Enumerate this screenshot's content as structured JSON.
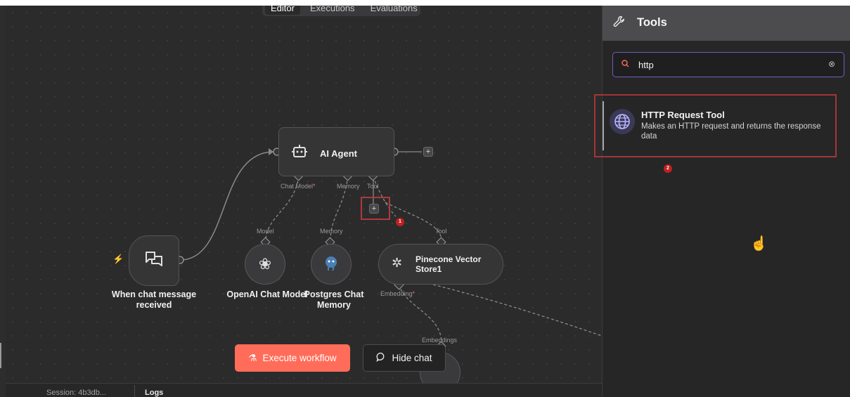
{
  "tabs": [
    "Editor",
    "Executions",
    "Evaluations"
  ],
  "nodes": {
    "agent": {
      "title": "AI Agent",
      "icon": "robot-icon"
    },
    "trigger": {
      "title": "When chat message received",
      "icon": "chat-bubbles-icon"
    },
    "openai": {
      "title": "OpenAI Chat Model",
      "icon": "openai-icon"
    },
    "postgres": {
      "title": "Postgres Chat Memory",
      "icon": "postgres-elephant-icon"
    },
    "pinecone": {
      "title": "Pinecone Vector Store1",
      "icon": "pinecone-icon"
    }
  },
  "ports": {
    "chat_model": "Chat Model",
    "memory": "Memory",
    "tool": "Tool",
    "model": "Model",
    "memory2": "Memory",
    "tool2": "Tool",
    "embedding": "Embedding",
    "embeddings": "Embeddings",
    "required_mark": "*"
  },
  "buttons": {
    "execute": "Execute workflow",
    "hide_chat": "Hide chat",
    "plus": "+"
  },
  "logs_bar": {
    "session": "Session: 4b3db...",
    "logs": "Logs"
  },
  "badges": [
    "1",
    "2"
  ],
  "panel": {
    "title": "Tools",
    "search_value": "http",
    "result_title": "HTTP Request Tool",
    "result_desc": "Makes an HTTP request and returns the response data"
  },
  "colors": {
    "accent": "#ff6d5a",
    "highlight": "#b03a3a",
    "badge": "#c0201f",
    "search_border": "#6b5fbf"
  }
}
